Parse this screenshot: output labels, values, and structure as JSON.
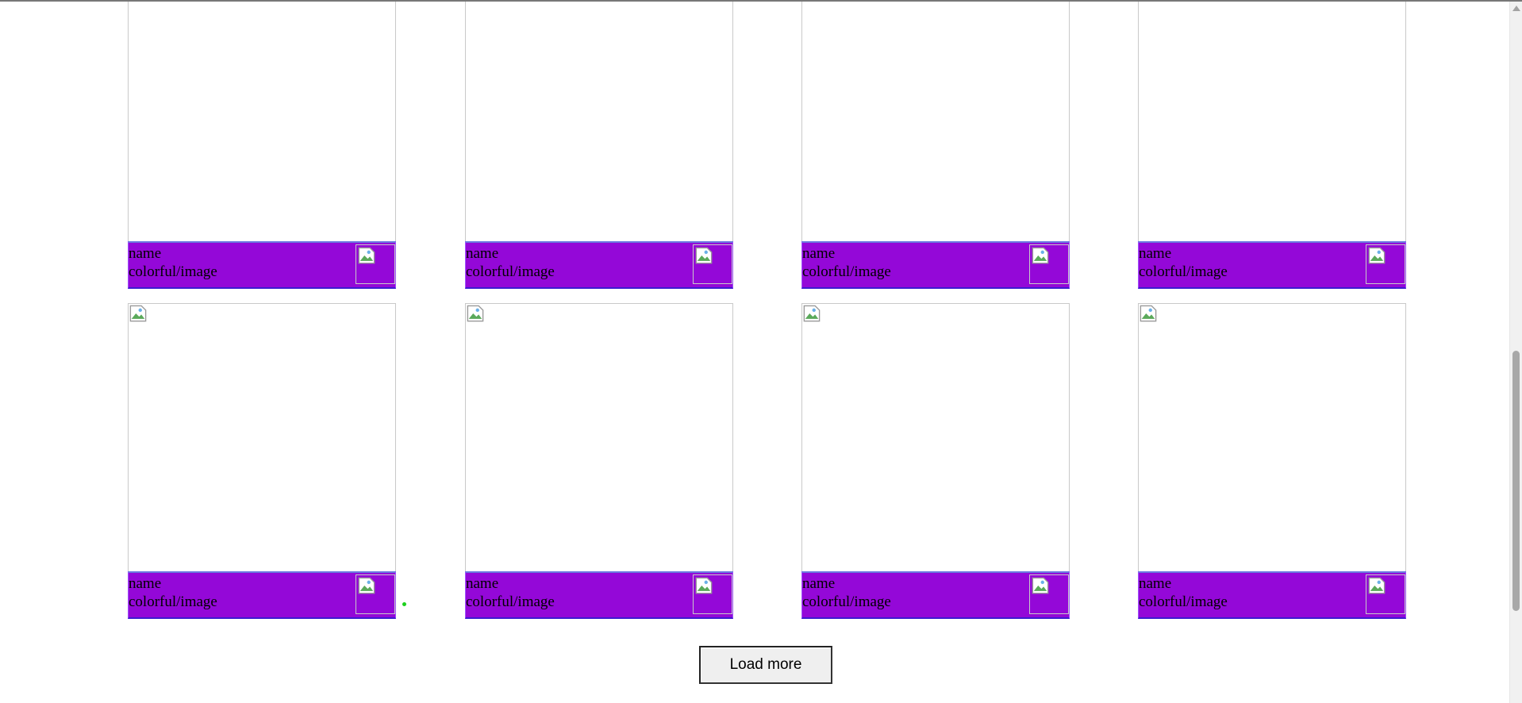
{
  "gallery": {
    "cards": [
      {
        "name": "name",
        "path": "colorful/image"
      },
      {
        "name": "name",
        "path": "colorful/image"
      },
      {
        "name": "name",
        "path": "colorful/image"
      },
      {
        "name": "name",
        "path": "colorful/image"
      },
      {
        "name": "name",
        "path": "colorful/image"
      },
      {
        "name": "name",
        "path": "colorful/image"
      },
      {
        "name": "name",
        "path": "colorful/image"
      },
      {
        "name": "name",
        "path": "colorful/image"
      }
    ]
  },
  "load_more": {
    "label": "Load more"
  },
  "colors": {
    "card_footer": "#9408d8",
    "indicator_dot": "#1dd11d"
  },
  "icons": {
    "broken_image": "broken-image-icon",
    "scroll_up": "scroll-up-arrow-icon"
  }
}
